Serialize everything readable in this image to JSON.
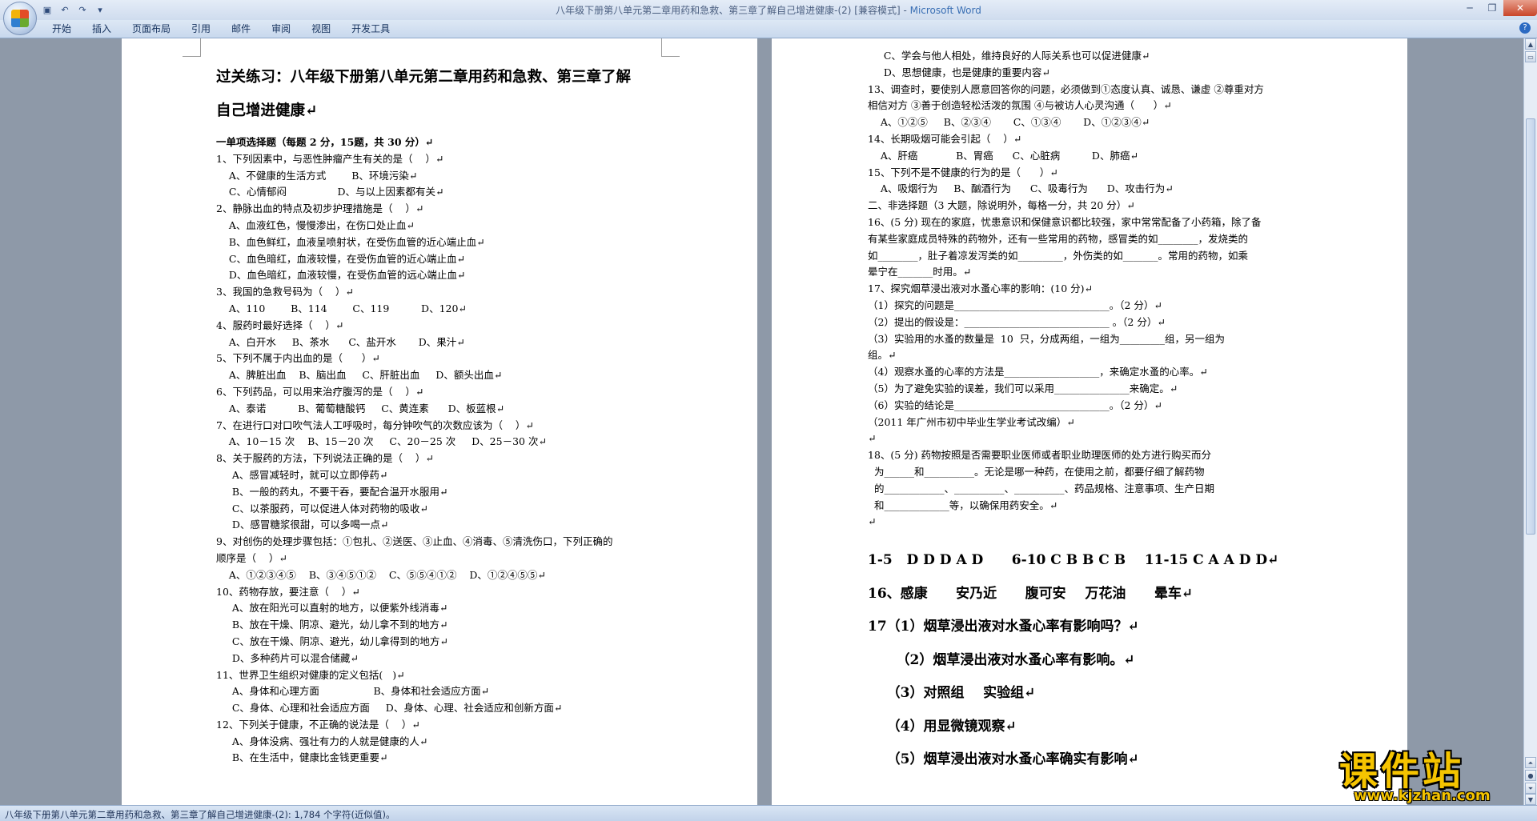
{
  "window": {
    "title": "八年级下册第八单元第二章用药和急救、第三章了解自己增进健康-(2) [兼容模式] - ",
    "app_name": "Microsoft Word",
    "minimize_icon": "minimize-icon",
    "maximize_icon": "restore-icon",
    "close_icon": "close-icon"
  },
  "quick_access": {
    "save_icon": "save-icon",
    "undo_icon": "undo-icon",
    "redo_icon": "redo-icon",
    "customize_icon": "dropdown-icon"
  },
  "ribbon": {
    "tabs": [
      "开始",
      "插入",
      "页面布局",
      "引用",
      "邮件",
      "审阅",
      "视图",
      "开发工具"
    ],
    "help": "?"
  },
  "page1": {
    "title_lines": [
      "过关练习：八年级下册第八单元第二章用药和急救、第三章了解",
      "自己增进健康↵",
      "↵"
    ],
    "lines": [
      "一单项选择题（每题 2 分，15题，共 30 分）↵",
      "1、下列因素中，与恶性肿瘤产生有关的是（    ）↵",
      "    A、不健康的生活方式        B、环境污染↵",
      "    C、心情郁闷                D、与以上因素都有关↵",
      "2、静脉出血的特点及初步护理措施是（    ）↵",
      "    A、血液红色，慢慢渗出，在伤口处止血↵",
      "    B、血色鲜红，血液呈喷射状，在受伤血管的近心端止血↵",
      "    C、血色暗红，血液较慢，在受伤血管的近心端止血↵",
      "    D、血色暗红，血液较慢，在受伤血管的远心端止血↵",
      "3、我国的急救号码为（    ）↵",
      "    A、110        B、114        C、119          D、120↵",
      "4、服药时最好选择（    ）↵",
      "    A、白开水     B、茶水      C、盐开水       D、果汁↵",
      "5、下列不属于内出血的是（      ）↵",
      "    A、脾脏出血    B、脑出血     C、肝脏出血     D、额头出血↵",
      "6、下列药品，可以用来治疗腹泻的是（    ）↵",
      "    A、泰诺          B、葡萄糖酸钙     C、黄连素      D、板蓝根↵",
      "7、在进行口对口吹气法人工呼吸时，每分钟吹气的次数应该为（    ）↵",
      "    A、10－15 次    B、15－20 次     C、20－25 次     D、25－30 次↵",
      "8、关于服药的方法，下列说法正确的是（    ）↵",
      "     A、感冒减轻时，就可以立即停药↵",
      "     B、一般的药丸，不要干吞，要配合温开水服用↵",
      "     C、以茶服药，可以促进人体对药物的吸收↵",
      "     D、感冒糖浆很甜，可以多喝一点↵",
      "9、对创伤的处理步骤包括：①包扎、②送医、③止血、④消毒、⑤清洗伤口，下列正确的",
      "顺序是（    ）↵",
      "    A、①②③④⑤    B、③④⑤①②    C、⑤⑤④①②    D、①②④⑤⑤↵",
      "10、药物存放，要注意（    ）↵",
      "     A、放在阳光可以直射的地方，以便紫外线消毒↵",
      "     B、放在干燥、阴凉、避光，幼儿拿不到的地方↵",
      "     C、放在干燥、阴凉、避光，幼儿拿得到的地方↵",
      "     D、多种药片可以混合储藏↵",
      "11、世界卫生组织对健康的定义包括(   )↵",
      "     A、身体和心理方面                 B、身体和社会适应方面↵",
      "     C、身体、心理和社会适应方面     D、身体、心理、社会适应和创新方面↵",
      "12、下列关于健康，不正确的说法是（    ）↵",
      "     A、身体没病、强壮有力的人就是健康的人↵",
      "     B、在生活中，健康比金钱更重要↵"
    ]
  },
  "page2": {
    "lines": [
      "     C、学会与他人相处，维持良好的人际关系也可以促进健康↵",
      "     D、思想健康，也是健康的重要内容↵",
      "13、调查时，要使别人愿意回答你的问题，必须做到①态度认真、诚恳、谦虚 ②尊重对方",
      "相信对方 ③善于创造轻松活泼的氛围 ④与被访人心灵沟通（      ）↵",
      "    A、①②⑤     B、②③④       C、①③④       D、①②③④↵",
      "14、长期吸烟可能会引起（    ）↵",
      "    A、肝癌            B、胃癌      C、心脏病          D、肺癌↵",
      "15、下列不是不健康的行为的是（      ）↵",
      "    A、吸烟行为     B、酗酒行为      C、吸毒行为      D、攻击行为↵",
      "二、非选择题（3 大题，除说明外，每格一分，共 20 分）↵",
      "16、(5 分) 现在的家庭，忧患意识和保健意识都比较强，家中常常配备了小药箱，除了备",
      "有某些家庭成员特殊的药物外，还有一些常用的药物，感冒类的如________，发烧类的",
      "如________，肚子着凉发泻类的如_________，外伤类的如_______。常用的药物，如乘",
      "晕宁在_______时用。↵",
      "17、探究烟草浸出液对水蚤心率的影响：(10 分)↵",
      "（1）探究的问题是_______________________________。（2 分）↵",
      "（2）提出的假设是：_____________________________ 。（2 分）↵",
      "（3）实验用的水蚤的数量是  10  只，分成两组，一组为_________组，另一组为",
      "组。↵",
      "（4）观察水蚤的心率的方法是___________________，来确定水蚤的心率。↵",
      "（5）为了避免实验的误差，我们可以采用_______________来确定。↵",
      "（6）实验的结论是_______________________________。（2 分）↵",
      "（2011 年广州市初中毕业生学业考试改编）↵",
      "↵",
      "18、(5 分) 药物按照是否需要职业医师或者职业助理医师的处方进行购买而分",
      "  为______和__________。无论是哪一种药，在使用之前，都要仔细了解药物",
      "  的____________、__________、__________、药品规格、注意事项、生产日期",
      "  和_____________等，以确保用药安全。↵",
      "↵"
    ],
    "answers": [
      "1-5   D D D A D      6-10 C B B C B    11-15 C A A D D↵",
      "16、感康      安乃近      腹可安    万花油      晕车↵",
      "17（1）烟草浸出液对水蚤心率有影响吗？↵",
      "      （2）烟草浸出液对水蚤心率有影响。↵",
      "    （3）对照组    实验组↵",
      "    （4）用显微镜观察↵",
      "    （5）烟草浸出液对水蚤心率确实有影响↵"
    ]
  },
  "statusbar": {
    "text": "八年级下册第八单元第二章用药和急救、第三章了解自己增进健康-(2): 1,784 个字符(近似值)。"
  },
  "watermark": {
    "main": "课件站",
    "url": "www.kjzhan.com"
  }
}
